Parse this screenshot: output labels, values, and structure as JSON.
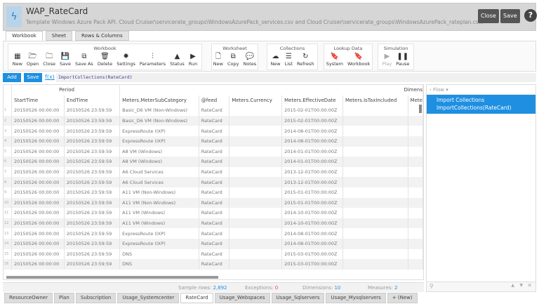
{
  "header": {
    "title": "WAP_RateCard",
    "subtitle": "Template Windows Azure Pack API. Cloud Cruiser\\servicerate_groups\\WindowsAzurePack_services.csv and Cloud Cruiser\\servicerate_groups\\WindowsAzurePack_rateplan.cs...",
    "close": "Close",
    "save": "Save",
    "help": "?"
  },
  "tabs": [
    "Workbook",
    "Sheet",
    "Rows & Columns"
  ],
  "ribbon": [
    {
      "title": "Workbook",
      "buttons": [
        [
          "New",
          "▦"
        ],
        [
          "Open",
          "🗁"
        ],
        [
          "Close",
          "🗀"
        ],
        [
          "Save",
          "💾"
        ],
        [
          "Save As",
          "⧉"
        ],
        [
          "Delete",
          "🗑"
        ],
        [
          "Settings",
          "✹"
        ],
        [
          "Parameters",
          "⫶"
        ],
        [
          "Status",
          "▲"
        ],
        [
          "Run",
          "▶"
        ]
      ]
    },
    {
      "title": "Worksheet",
      "buttons": [
        [
          "New",
          "🗋"
        ],
        [
          "Copy",
          "⧉"
        ],
        [
          "Notes",
          "💬"
        ]
      ]
    },
    {
      "title": "Collections",
      "buttons": [
        [
          "New",
          "☁"
        ],
        [
          "List",
          "☰"
        ],
        [
          "Refresh",
          "↻"
        ]
      ]
    },
    {
      "title": "Lookup Data",
      "buttons": [
        [
          "System",
          "🔖"
        ],
        [
          "Workbook",
          "🔖"
        ]
      ]
    },
    {
      "title": "Simulation",
      "buttons": [
        [
          "Play",
          "▶"
        ],
        [
          "Pause",
          "❚❚"
        ]
      ]
    }
  ],
  "formula": {
    "add": "Add",
    "save": "Save",
    "fx": "f(x)",
    "text": "ImportCollections(RateCard)"
  },
  "grid": {
    "groups": [
      "Period",
      "Dimens"
    ],
    "columns": [
      "StartTime",
      "EndTime",
      "Meters.MeterSubCategory",
      "@feed",
      "Meters.Currency",
      "Meters.EffectiveDate",
      "Meters.IsTaxIncluded",
      "Mete"
    ],
    "rows": [
      [
        "1",
        "20150526 00:00:00",
        "20150526 23:59:59",
        "Basic_D6 VM (Non-Windows)",
        "RateCard",
        "",
        "2015-02-01T00:00:00Z",
        ""
      ],
      [
        "2",
        "20150526 00:00:00",
        "20150526 23:59:59",
        "Basic_D6 VM (Non-Windows)",
        "RateCard",
        "",
        "2015-02-01T00:00:00Z",
        ""
      ],
      [
        "3",
        "20150526 00:00:00",
        "20150526 23:59:59",
        "ExpressRoute (IXP)",
        "RateCard",
        "",
        "2014-08-01T00:00:00Z",
        ""
      ],
      [
        "4",
        "20150526 00:00:00",
        "20150526 23:59:59",
        "ExpressRoute (IXP)",
        "RateCard",
        "",
        "2014-08-01T00:00:00Z",
        ""
      ],
      [
        "5",
        "20150526 00:00:00",
        "20150526 23:59:59",
        "A8 VM (Windows)",
        "RateCard",
        "",
        "2014-01-01T00:00:00Z",
        ""
      ],
      [
        "6",
        "20150526 00:00:00",
        "20150526 23:59:59",
        "A8 VM (Windows)",
        "RateCard",
        "",
        "2014-01-01T00:00:00Z",
        ""
      ],
      [
        "7",
        "20150526 00:00:00",
        "20150526 23:59:59",
        "A6 Cloud Services",
        "RateCard",
        "",
        "2013-12-01T00:00:00Z",
        ""
      ],
      [
        "8",
        "20150526 00:00:00",
        "20150526 23:59:59",
        "A6 Cloud Services",
        "RateCard",
        "",
        "2013-12-01T00:00:00Z",
        ""
      ],
      [
        "9",
        "20150526 00:00:00",
        "20150526 23:59:59",
        "A11 VM (Non-Windows)",
        "RateCard",
        "",
        "2015-01-01T00:00:00Z",
        ""
      ],
      [
        "10",
        "20150526 00:00:00",
        "20150526 23:59:59",
        "A11 VM (Non-Windows)",
        "RateCard",
        "",
        "2015-01-01T00:00:00Z",
        ""
      ],
      [
        "11",
        "20150526 00:00:00",
        "20150526 23:59:59",
        "A11 VM (Windows)",
        "RateCard",
        "",
        "2014-10-01T00:00:00Z",
        ""
      ],
      [
        "12",
        "20150526 00:00:00",
        "20150526 23:59:59",
        "A11 VM (Windows)",
        "RateCard",
        "",
        "2014-10-01T00:00:00Z",
        ""
      ],
      [
        "13",
        "20150526 00:00:00",
        "20150526 23:59:59",
        "ExpressRoute (IXP)",
        "RateCard",
        "",
        "2014-08-01T00:00:00Z",
        ""
      ],
      [
        "14",
        "20150526 00:00:00",
        "20150526 23:59:59",
        "ExpressRoute (IXP)",
        "RateCard",
        "",
        "2014-08-01T00:00:00Z",
        ""
      ],
      [
        "15",
        "20150526 00:00:00",
        "20150526 23:59:59",
        "DNS",
        "RateCard",
        "",
        "2015-03-01T00:00:00Z",
        ""
      ],
      [
        "16",
        "20150526 00:00:00",
        "20150526 23:59:59",
        "DNS",
        "RateCard",
        "",
        "2015-03-01T00:00:00Z",
        ""
      ]
    ]
  },
  "panel": {
    "title": "Flow",
    "items": [
      "Import Collections",
      "ImportCollections(RateCard)"
    ]
  },
  "status": {
    "sample_label": "Sample rows:",
    "sample": "2,892",
    "exc_label": "Exceptions:",
    "exc": "0",
    "dim_label": "Dimensions:",
    "dim": "10",
    "meas_label": "Measures:",
    "meas": "2"
  },
  "sheets": [
    "ResourceOwner",
    "Plan",
    "Subscription",
    "Usage_Systemcenter",
    "RateCard",
    "Usage_Webspaces",
    "Usage_Sqlservers",
    "Usage_Mysqlservers",
    "+ (New)"
  ],
  "active_sheet": "RateCard"
}
